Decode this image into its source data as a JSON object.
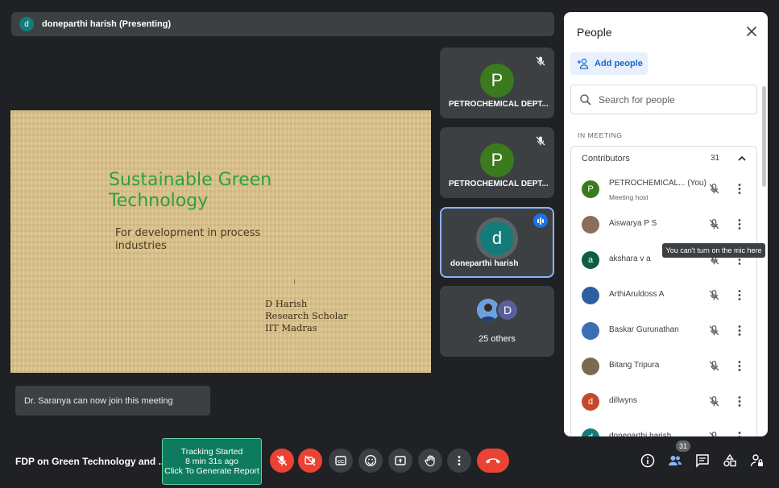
{
  "presenter": {
    "avatar_letter": "d",
    "label": "doneparthi harish (Presenting)"
  },
  "slide": {
    "title": "Sustainable Green Technology",
    "subtitle": "For development in process industries",
    "author_lines": [
      "D Harish",
      "Research Scholar",
      "IIT Madras"
    ]
  },
  "tiles": [
    {
      "letter": "P",
      "name": "PETROCHEMICAL DEPT...",
      "muted": true
    },
    {
      "letter": "P",
      "name": "PETROCHEMICAL DEPT...",
      "muted": true
    },
    {
      "letter": "d",
      "name": "doneparthi harish",
      "speaking": true
    },
    {
      "other_letter": "D",
      "name": "25 others"
    }
  ],
  "toast": "Dr. Saranya can now join this meeting",
  "bottom": {
    "meeting_title": "FDP on Green Technology and ...",
    "tracking": [
      "Tracking Started",
      "8 min 31s ago",
      "Click To Generate Report"
    ],
    "people_badge": "31"
  },
  "panel": {
    "title": "People",
    "add_people": "Add people",
    "search_placeholder": "Search for people",
    "in_meeting": "IN MEETING",
    "contributors_label": "Contributors",
    "contributors_count": "31",
    "participants": [
      {
        "letter": "P",
        "color": "#3b7a1d",
        "name": "PETROCHEMICAL... (You)",
        "sub": "Meeting host"
      },
      {
        "letter": "",
        "color": "#8a6e5a",
        "name": "Aiswarya P S",
        "sub": ""
      },
      {
        "letter": "a",
        "color": "#0b5e3e",
        "name": "akshara v a",
        "sub": ""
      },
      {
        "letter": "",
        "color": "#2f5f9e",
        "name": "ArthiAruldoss A",
        "sub": ""
      },
      {
        "letter": "",
        "color": "#3a6fb5",
        "name": "Baskar Gurunathan",
        "sub": ""
      },
      {
        "letter": "",
        "color": "#7a6b4f",
        "name": "Bitang Tripura",
        "sub": ""
      },
      {
        "letter": "d",
        "color": "#c5492c",
        "name": "dillwyns",
        "sub": ""
      },
      {
        "letter": "d",
        "color": "#137c7a",
        "name": "doneparthi harish",
        "sub": ""
      }
    ],
    "tooltip": "You can't turn on the mic here"
  }
}
